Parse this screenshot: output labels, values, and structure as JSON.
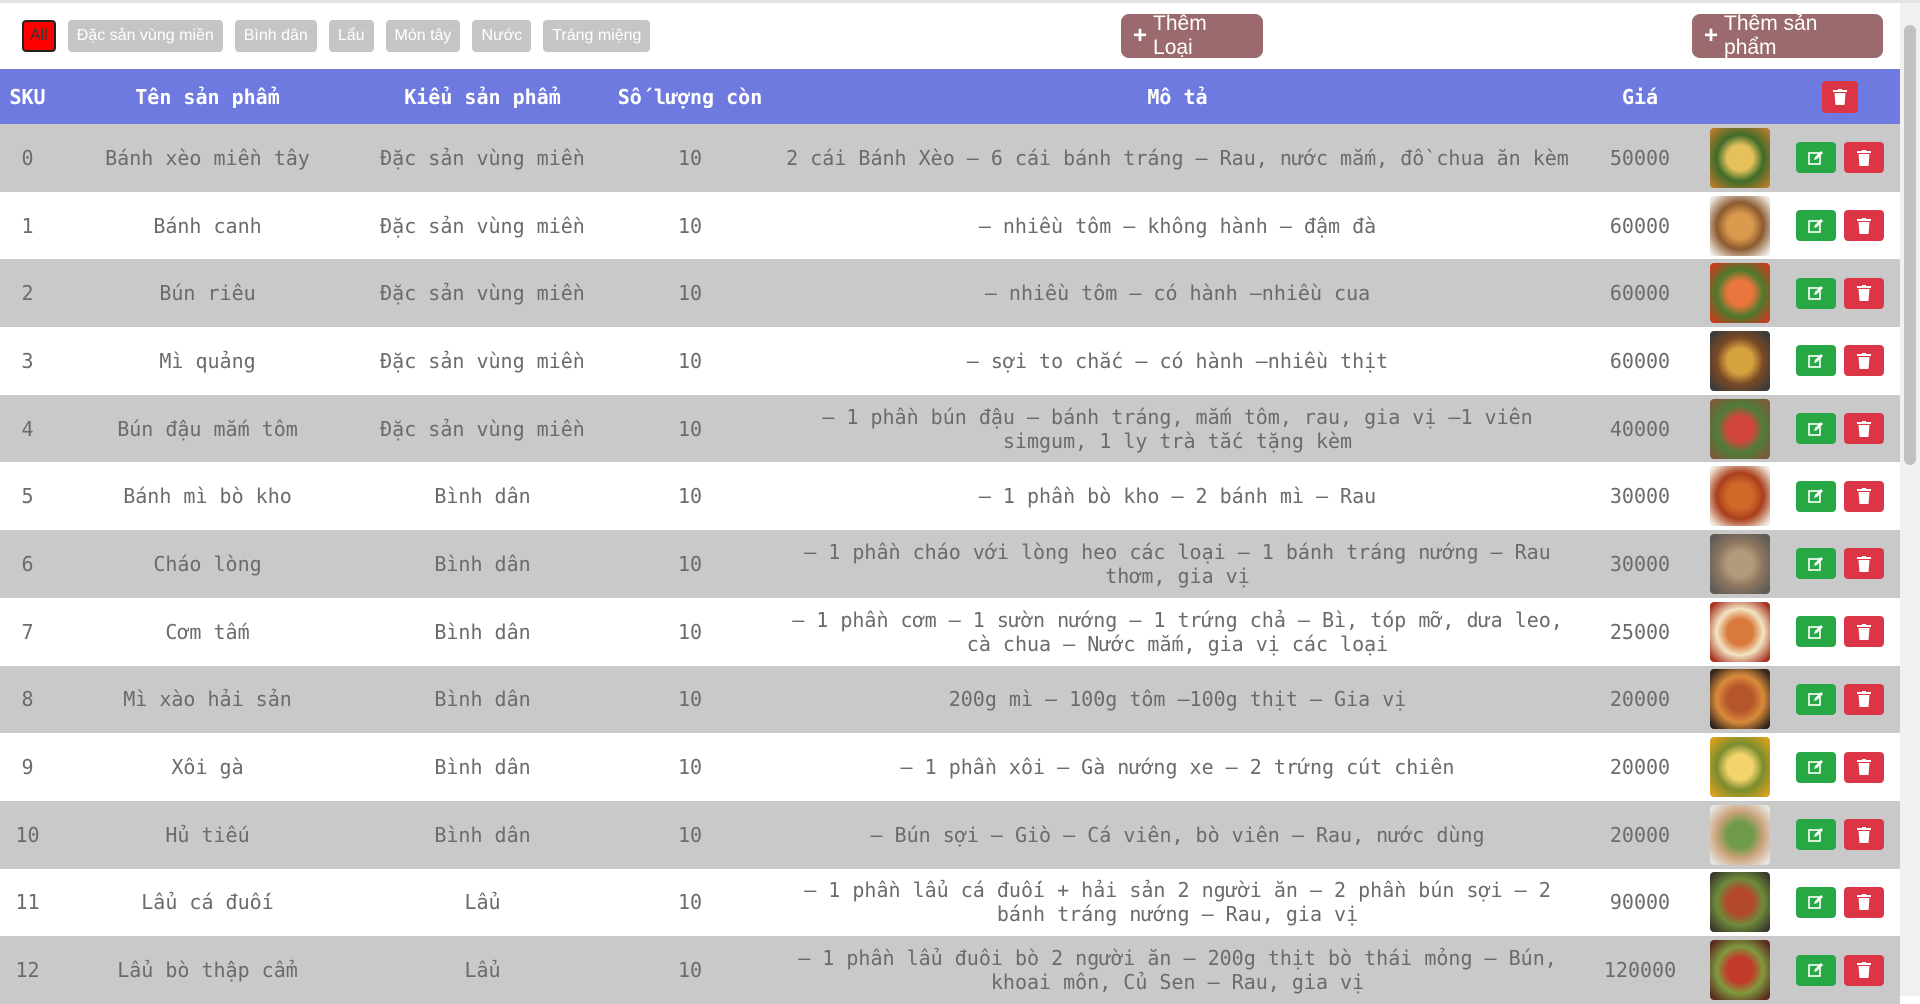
{
  "filters": [
    "All",
    "Đặc sản vùng miền",
    "Bình dân",
    "Lẩu",
    "Món tây",
    "Nước",
    "Tráng miệng"
  ],
  "active_filter": "All",
  "buttons": {
    "add_type": "Thêm Loại",
    "add_product": "Thêm sản phẩm"
  },
  "table": {
    "headers": [
      "SKU",
      "Tên sản phẩm",
      "Kiểu sản phẩm",
      "Số lượng còn",
      "Mô tả",
      "Giá"
    ],
    "rows": [
      {
        "sku": "0",
        "name": "Bánh xèo miền tây",
        "type": "Đặc sản vùng miền",
        "qty": "10",
        "desc": "2 cái Bánh Xèo – 6 cái bánh tráng – Rau, nước mắm, đồ chua ăn kèm",
        "price": "50000",
        "thumb": [
          "#b07a2a",
          "#e6c15a",
          "#3f6b2a"
        ]
      },
      {
        "sku": "1",
        "name": "Bánh canh",
        "type": "Đặc sản vùng miền",
        "qty": "10",
        "desc": "– nhiều tôm – không hành – đậm đà",
        "price": "60000",
        "thumb": [
          "#e9e4dc",
          "#d99a4e",
          "#8c5a2f"
        ]
      },
      {
        "sku": "2",
        "name": "Bún riêu",
        "type": "Đặc sản vùng miền",
        "qty": "10",
        "desc": "– nhiều tôm – có hành –nhiều cua",
        "price": "60000",
        "thumb": [
          "#c43d1f",
          "#e9763c",
          "#4d7a2d"
        ]
      },
      {
        "sku": "3",
        "name": "Mì quảng",
        "type": "Đặc sản vùng miền",
        "qty": "10",
        "desc": "– sợi to chắc – có hành –nhiều thịt",
        "price": "60000",
        "thumb": [
          "#3a3b3a",
          "#d6a23e",
          "#7b4a26"
        ]
      },
      {
        "sku": "4",
        "name": "Bún đậu mắm tôm",
        "type": "Đặc sản vùng miền",
        "qty": "10",
        "desc": "– 1 phần bún đậu – bánh tráng, mắm tôm, rau, gia vị –1 viên simgum, 1 ly trà tắc tặng kèm",
        "price": "40000",
        "thumb": [
          "#7a5a3b",
          "#d1453a",
          "#4f7d3a"
        ]
      },
      {
        "sku": "5",
        "name": "Bánh mì bò kho",
        "type": "Bình dân",
        "qty": "10",
        "desc": "– 1 phần bò kho – 2 bánh mì – Rau",
        "price": "30000",
        "thumb": [
          "#f0e6d8",
          "#d2692a",
          "#a83f1c"
        ]
      },
      {
        "sku": "6",
        "name": "Cháo lòng",
        "type": "Bình dân",
        "qty": "10",
        "desc": "– 1 phần cháo với lòng heo các loại – 1 bánh tráng nướng – Rau thơm, gia vị",
        "price": "30000",
        "thumb": [
          "#5e5a55",
          "#b49a7c",
          "#8a7460"
        ]
      },
      {
        "sku": "7",
        "name": "Cơm tấm",
        "type": "Bình dân",
        "qty": "10",
        "desc": "– 1 phần cơm – 1 sườn nướng – 1 trứng chả – Bì, tóp mỡ, dưa leo, cà chua – Nước mắm, gia vị các loại",
        "price": "25000",
        "thumb": [
          "#a9321f",
          "#d9793a",
          "#f2e3c3"
        ]
      },
      {
        "sku": "8",
        "name": "Mì xào hải sản",
        "type": "Bình dân",
        "qty": "10",
        "desc": "200g mì – 100g tôm –100g thịt – Gia vị",
        "price": "20000",
        "thumb": [
          "#2f231b",
          "#b5552a",
          "#d98b3a"
        ]
      },
      {
        "sku": "9",
        "name": "Xôi gà",
        "type": "Bình dân",
        "qty": "10",
        "desc": "– 1 phần xôi – Gà nướng xe – 2 trứng cút chiên",
        "price": "20000",
        "thumb": [
          "#d8a11f",
          "#f3d36b",
          "#7b8c2e"
        ]
      },
      {
        "sku": "10",
        "name": "Hủ tiếu",
        "type": "Bình dân",
        "qty": "10",
        "desc": "– Bún sợi – Giò – Cá viên, bò viên – Rau, nước dùng",
        "price": "20000",
        "thumb": [
          "#e8e4de",
          "#6f9a4a",
          "#c9a27a"
        ]
      },
      {
        "sku": "11",
        "name": "Lẩu cá đuối",
        "type": "Lẩu",
        "qty": "10",
        "desc": "– 1 phần lẩu cá đuối + hải sản 2 người ăn – 2 phần bún sợi – 2 bánh tráng nướng – Rau, gia vị",
        "price": "90000",
        "thumb": [
          "#3b3a2c",
          "#b3472a",
          "#6e8b3a"
        ]
      },
      {
        "sku": "12",
        "name": "Lẩu bò thập cẩm",
        "type": "Lẩu",
        "qty": "10",
        "desc": "– 1 phần lẩu đuôi bò 2 người ăn – 200g thịt bò thái mỏng – Bún, khoai môn, Củ Sen – Rau, gia vị",
        "price": "120000",
        "thumb": [
          "#5a2a1f",
          "#c23b2a",
          "#7f9a3e"
        ]
      }
    ]
  },
  "colors": {
    "header": "#6f7ae0",
    "odd_row": "#c9c9c9",
    "edit": "#28a745",
    "delete": "#dc3545",
    "brown_button": "#9b6a6e"
  },
  "icons": {
    "edit": "edit-icon",
    "delete": "trash-icon",
    "add": "plus-icon"
  }
}
